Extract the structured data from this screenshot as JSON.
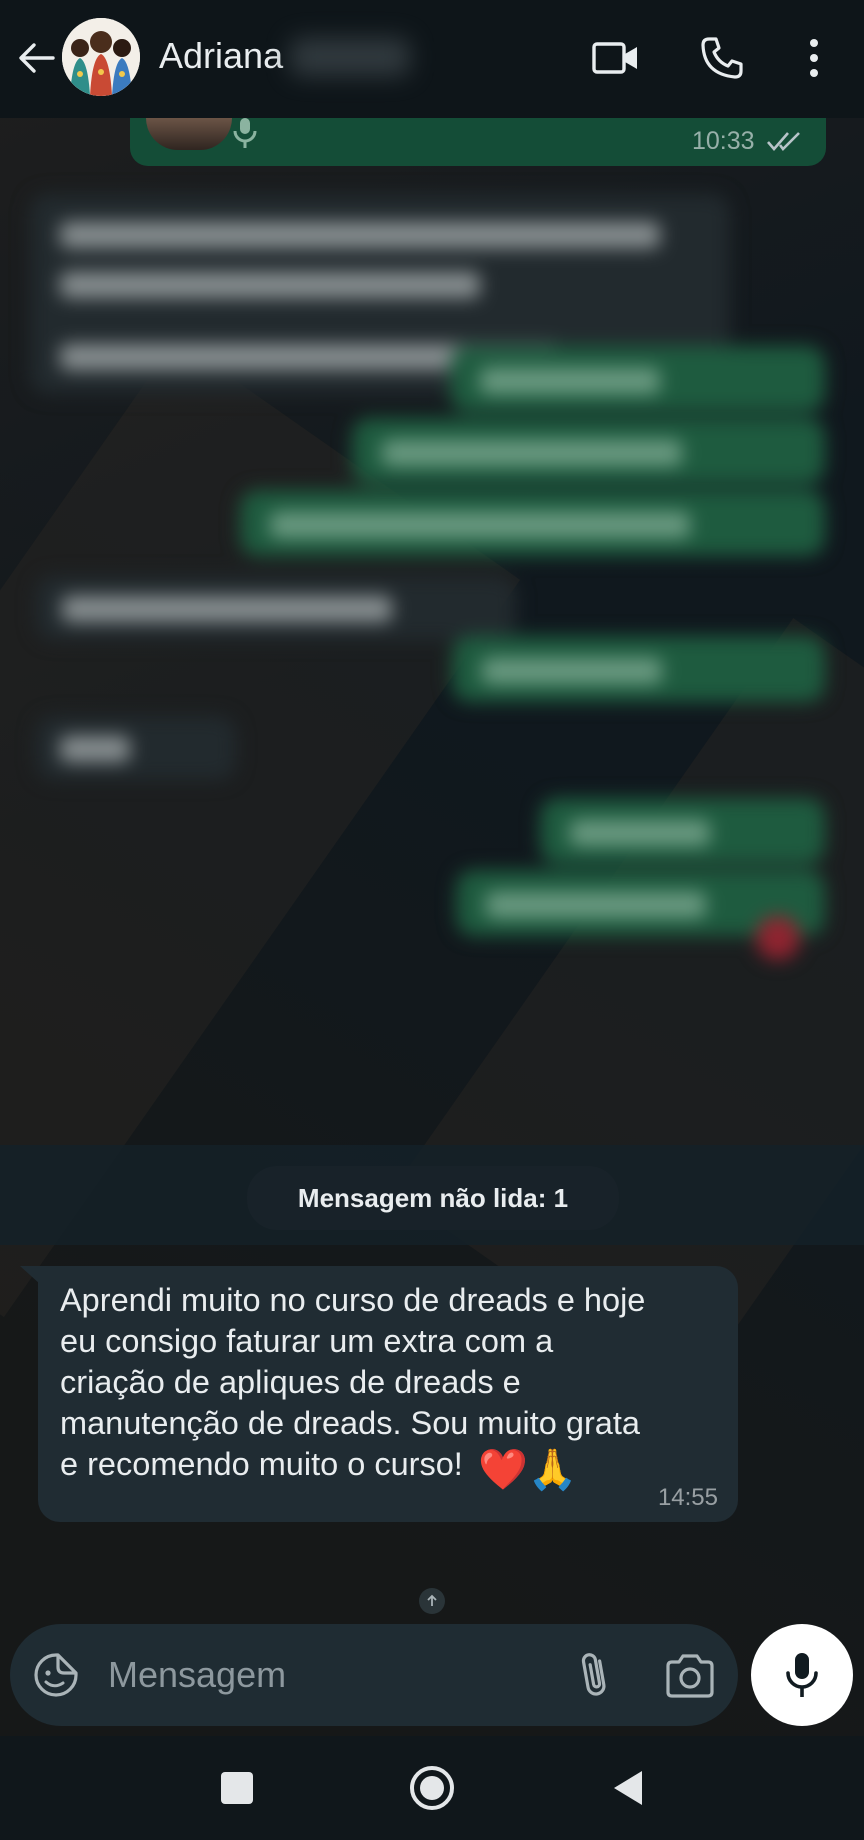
{
  "header": {
    "contact_name": "Adriana",
    "icons": {
      "back": "arrow-left-icon",
      "video": "video-call-icon",
      "call": "phone-icon",
      "menu": "more-vert-icon"
    }
  },
  "chat": {
    "top_voice_message": {
      "time": "10:33",
      "status": "read"
    },
    "unread_divider": "Mensagem não lida: 1",
    "received_message": {
      "text": "Aprendi muito no curso de dreads e hoje eu consigo faturar um extra com a criação de apliques de dreads e manutenção de dreads. Sou muito grata e recomendo muito o curso!",
      "emoji": "❤️🙏",
      "time": "14:55"
    }
  },
  "composer": {
    "placeholder": "Mensagem",
    "icons": {
      "emoji": "sticker-emoji-icon",
      "attach": "paperclip-icon",
      "camera": "camera-icon",
      "mic": "microphone-icon"
    }
  },
  "navbar": {
    "icons": [
      "recents-square-icon",
      "home-circle-icon",
      "back-triangle-icon"
    ]
  },
  "colors": {
    "header_bg": "#0e1519",
    "incoming_bubble": "#202c33",
    "outgoing_bubble": "#144d37",
    "text_primary": "#e9edef",
    "text_secondary": "#8d989e",
    "composer_bg": "#1f2c33",
    "mic_button": "#ffffff"
  }
}
